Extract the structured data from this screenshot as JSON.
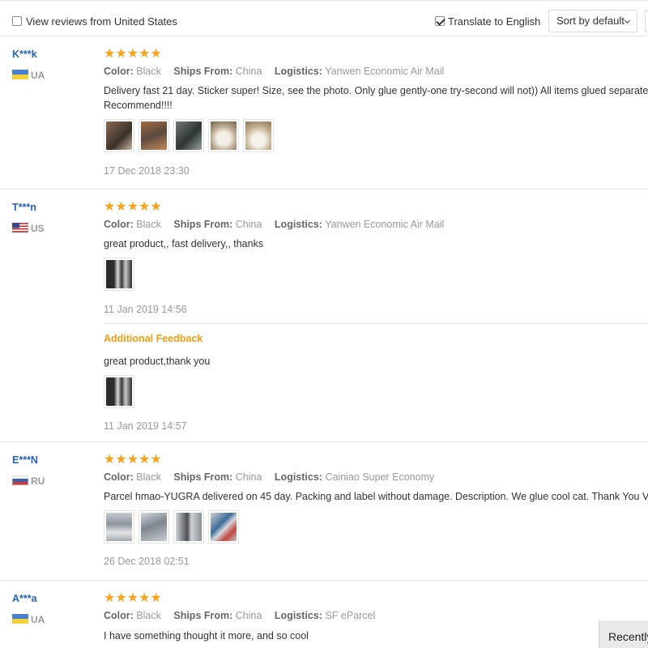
{
  "toolbar": {
    "view_reviews_label": "View reviews from United States",
    "view_reviews_checked": false,
    "translate_label": "Translate to English",
    "translate_checked": true,
    "sort_label": "Sort by default"
  },
  "reviews": [
    {
      "user": "K***k",
      "country": "UA",
      "stars": "★★★★★",
      "color_label": "Color:",
      "color_value": "Black",
      "ships_label": "Ships From:",
      "ships_value": "China",
      "logistics_label": "Logistics:",
      "logistics_value": "Yanwen Economic Air Mail",
      "text_line1": "Delivery fast 21 day. Sticker super! Size, see the photo. Only glue gently-one try-second will not)) All items glued separately.",
      "text_line2": "Recommend!!!!",
      "date": "17 Dec 2018 23:30"
    },
    {
      "user": "T***n",
      "country": "US",
      "stars": "★★★★★",
      "color_label": "Color:",
      "color_value": "Black",
      "ships_label": "Ships From:",
      "ships_value": "China",
      "logistics_label": "Logistics:",
      "logistics_value": "Yanwen Economic Air Mail",
      "text_line1": "great product,, fast delivery,, thanks",
      "date": "11 Jan 2019 14:56",
      "additional": {
        "title": "Additional Feedback",
        "text": "great product,thank you",
        "date": "11 Jan 2019 14:57"
      }
    },
    {
      "user": "E***N",
      "country": "RU",
      "stars": "★★★★★",
      "color_label": "Color:",
      "color_value": "Black",
      "ships_label": "Ships From:",
      "ships_value": "China",
      "logistics_label": "Logistics:",
      "logistics_value": "Cainiao Super Economy",
      "text_line1": "Parcel hmao-YUGRA delivered on 45 day. Packing and label without damage. Description. We glue cool cat. Thank You Very",
      "date": "26 Dec 2018 02:51"
    },
    {
      "user": "A***a",
      "country": "UA",
      "stars": "★★★★★",
      "color_label": "Color:",
      "color_value": "Black",
      "ships_label": "Ships From:",
      "ships_value": "China",
      "logistics_label": "Logistics:",
      "logistics_value": "SF eParcel",
      "text_line1": "I have something thought it more, and so cool"
    }
  ],
  "recently_label": "Recently",
  "colors": {
    "accent_star": "#f7a31c",
    "username": "#2662b8",
    "additional_feedback": "#f39c12"
  }
}
